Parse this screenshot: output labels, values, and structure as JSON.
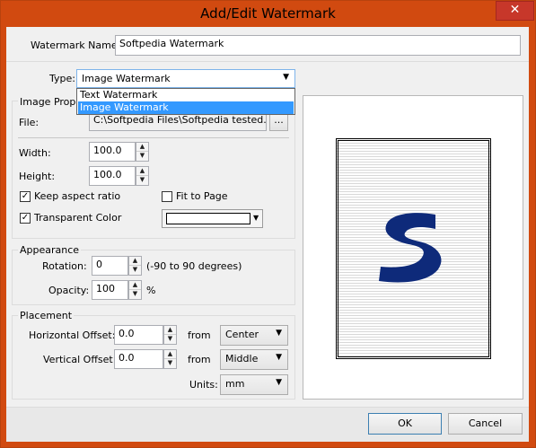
{
  "window": {
    "title": "Add/Edit Watermark",
    "close_glyph": "✕"
  },
  "name_row": {
    "label": "Watermark Name:",
    "value": "Softpedia Watermark"
  },
  "type_row": {
    "label": "Type:",
    "value": "Image Watermark",
    "options": [
      "Text Watermark",
      "Image Watermark"
    ],
    "selected_index": 1
  },
  "image_properties": {
    "group_title": "Image Prope",
    "file_label": "File:",
    "file_value": "C:\\Softpedia Files\\Softpedia tested.jp",
    "browse_label": "...",
    "width_label": "Width:",
    "width_value": "100.0",
    "height_label": "Height:",
    "height_value": "100.0",
    "keep_aspect_label": "Keep aspect ratio",
    "keep_aspect_checked": true,
    "fit_to_page_label": "Fit to Page",
    "fit_to_page_checked": false,
    "transparent_label": "Transparent Color",
    "transparent_checked": true
  },
  "appearance": {
    "group_title": "Appearance",
    "rotation_label": "Rotation:",
    "rotation_value": "0",
    "rotation_hint": "(-90 to 90 degrees)",
    "opacity_label": "Opacity:",
    "opacity_value": "100",
    "opacity_unit": "%"
  },
  "placement": {
    "group_title": "Placement",
    "h_offset_label": "Horizontal Offset:",
    "h_offset_value": "0.0",
    "h_from_label": "from",
    "h_from_value": "Center",
    "v_offset_label": "Vertical Offset:",
    "v_offset_value": "0.0",
    "v_from_label": "from",
    "v_from_value": "Middle",
    "units_label": "Units:",
    "units_value": "mm"
  },
  "buttons": {
    "ok": "OK",
    "cancel": "Cancel"
  },
  "colors": {
    "accent": "#3399ff",
    "frame": "#d14a10",
    "logo": "#0e2a7a"
  }
}
